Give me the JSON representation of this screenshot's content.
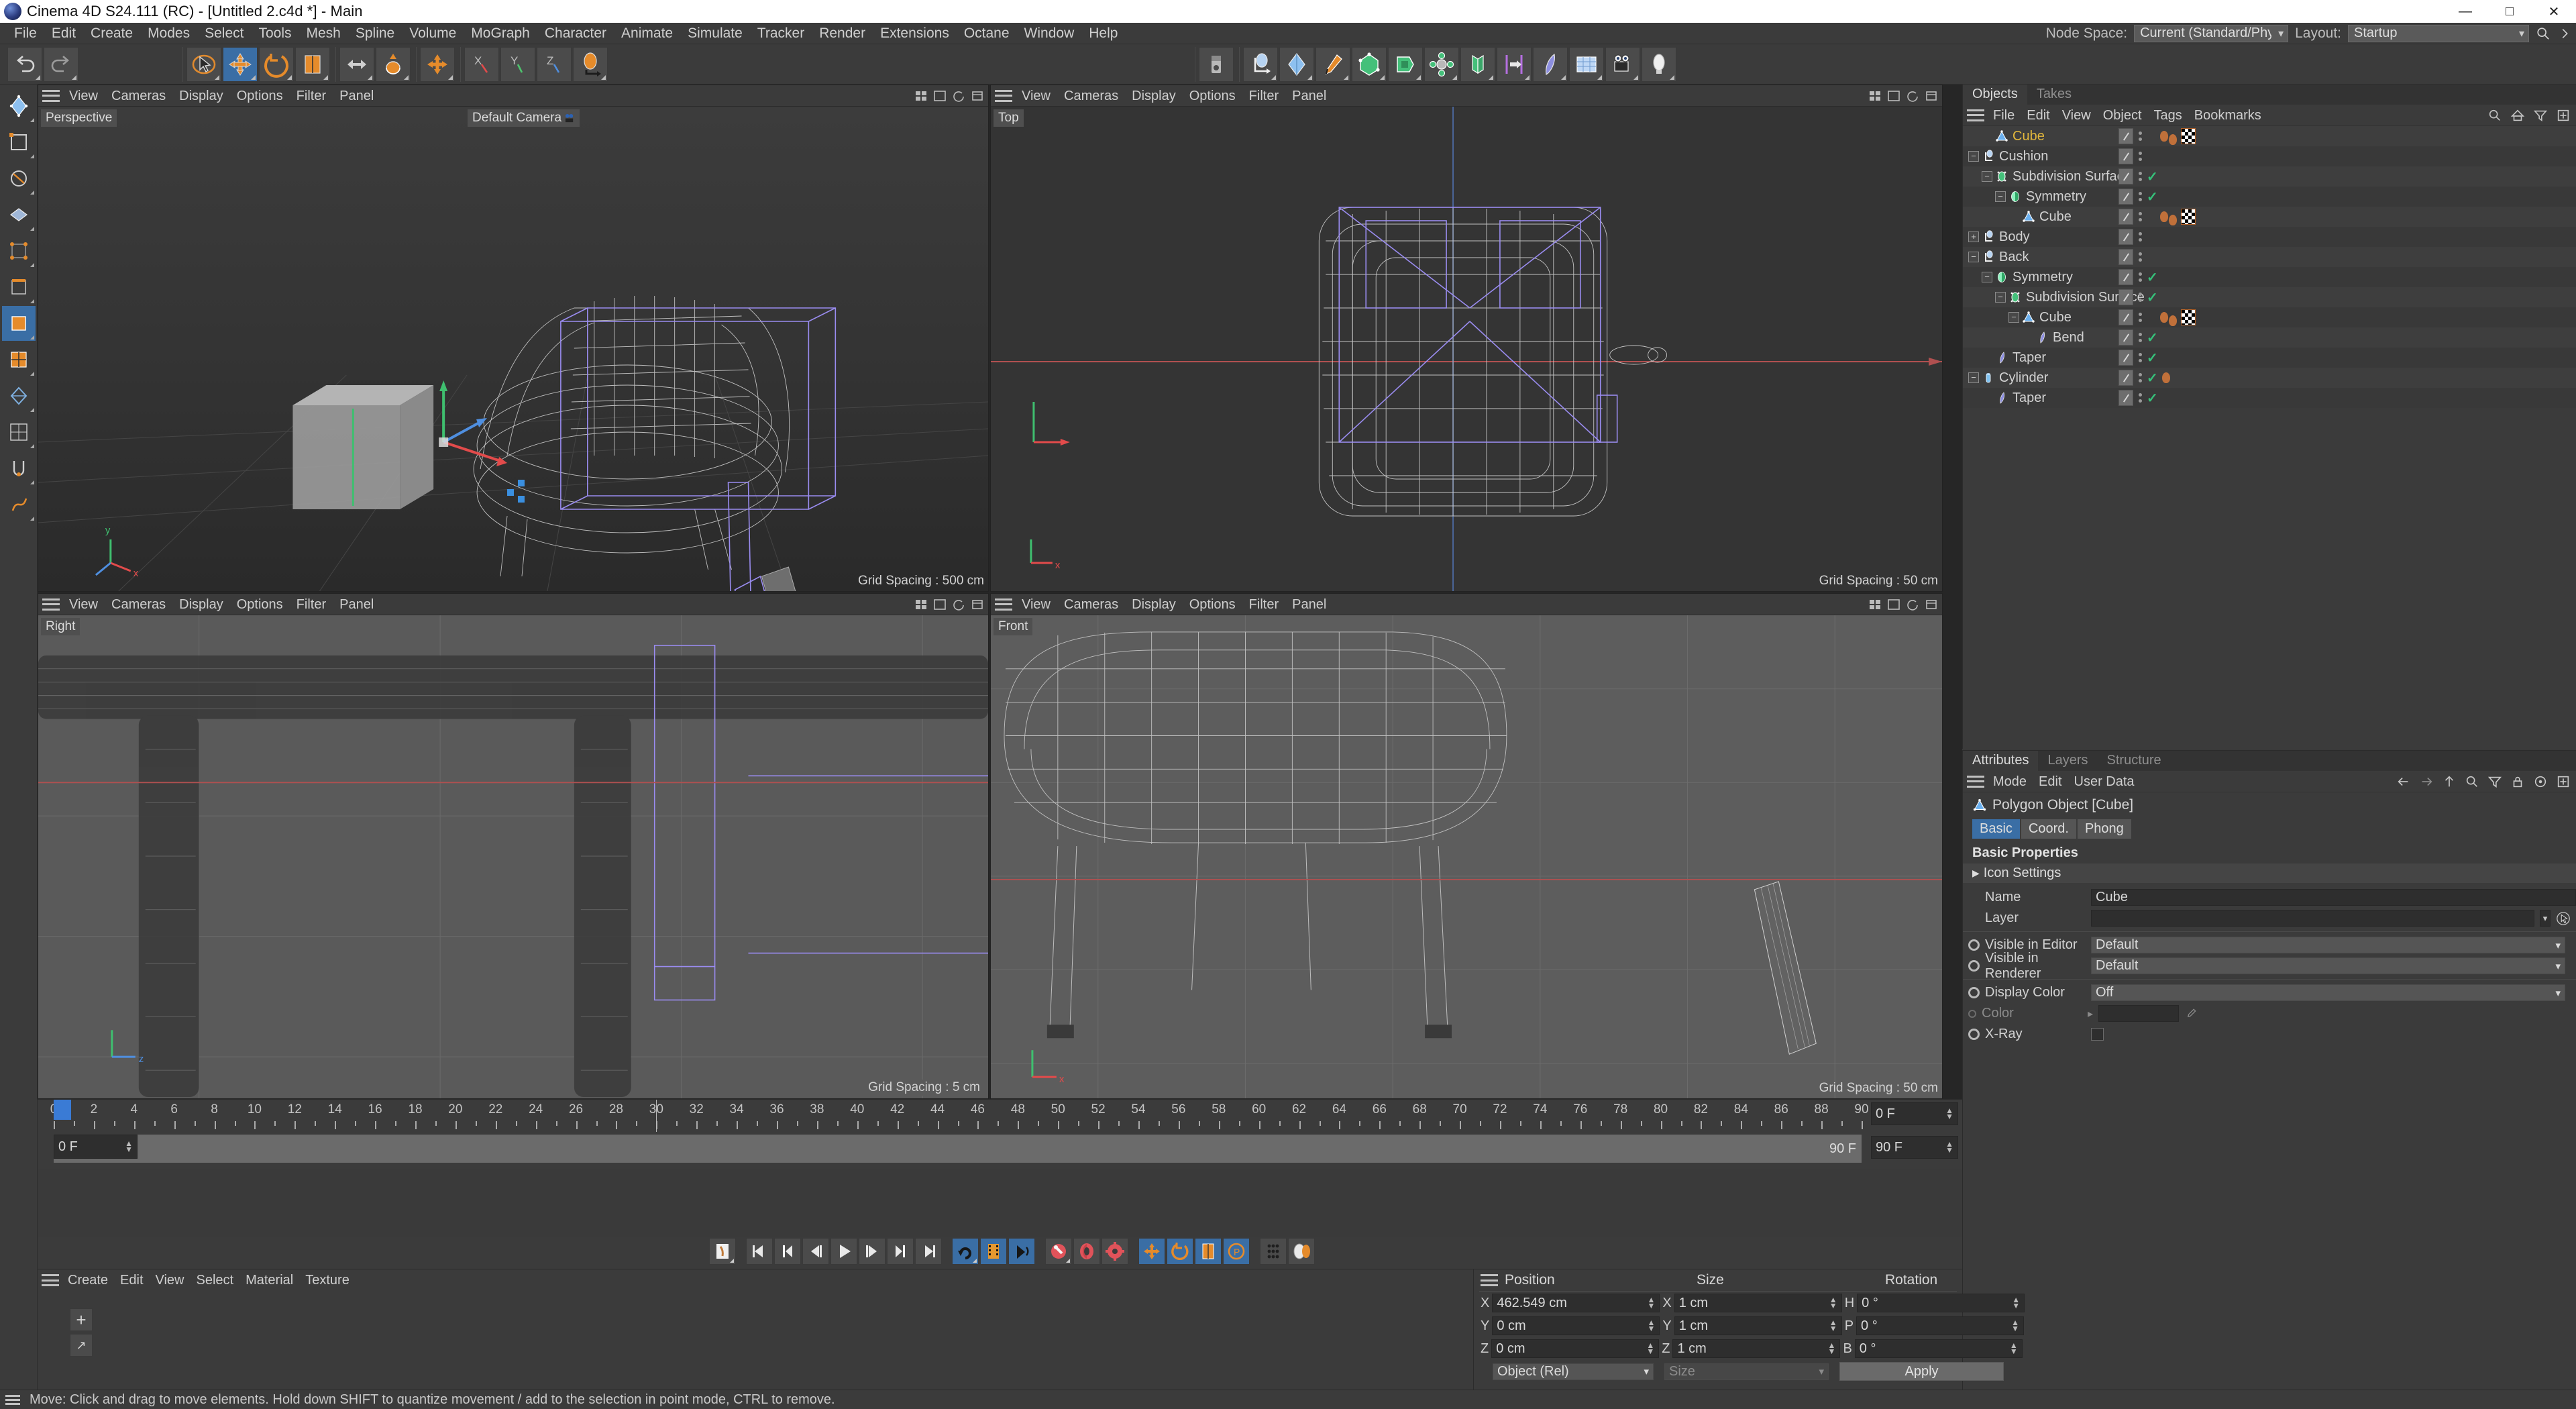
{
  "window": {
    "title": "Cinema 4D S24.111 (RC) - [Untitled 2.c4d *] - Main",
    "minimize": "—",
    "maximize": "□",
    "close": "✕"
  },
  "menubar": {
    "items": [
      "File",
      "Edit",
      "Create",
      "Modes",
      "Select",
      "Tools",
      "Mesh",
      "Spline",
      "Volume",
      "MoGraph",
      "Character",
      "Animate",
      "Simulate",
      "Tracker",
      "Render",
      "Extensions",
      "Octane",
      "Window",
      "Help"
    ],
    "node_space_label": "Node Space:",
    "node_space_value": "Current (Standard/Physical)",
    "layout_label": "Layout:",
    "layout_value": "Startup"
  },
  "viewports": [
    {
      "name": "Perspective",
      "menu": [
        "View",
        "Cameras",
        "Display",
        "Options",
        "Filter",
        "Panel"
      ],
      "camera": "Default Camera",
      "grid": "Grid Spacing : 500 cm",
      "grid_boxed": false
    },
    {
      "name": "Top",
      "menu": [
        "View",
        "Cameras",
        "Display",
        "Options",
        "Filter",
        "Panel"
      ],
      "camera": "",
      "grid": "Grid Spacing : 50 cm",
      "grid_boxed": false
    },
    {
      "name": "Right",
      "menu": [
        "View",
        "Cameras",
        "Display",
        "Options",
        "Filter",
        "Panel"
      ],
      "camera": "",
      "grid": "Grid Spacing : 5 cm",
      "grid_boxed": true
    },
    {
      "name": "Front",
      "menu": [
        "View",
        "Cameras",
        "Display",
        "Options",
        "Filter",
        "Panel"
      ],
      "camera": "",
      "grid": "Grid Spacing : 50 cm",
      "grid_boxed": false
    }
  ],
  "objects_panel": {
    "tabs": [
      {
        "label": "Objects",
        "active": true
      },
      {
        "label": "Takes",
        "active": false
      }
    ],
    "menu": [
      "File",
      "Edit",
      "View",
      "Object",
      "Tags",
      "Bookmarks"
    ],
    "tree": [
      {
        "name": "Cube",
        "depth": 1,
        "icon": "polygon",
        "expander": "none",
        "selected": true,
        "check": false,
        "beans": 2,
        "material": true
      },
      {
        "name": "Cushion",
        "depth": 0,
        "icon": "null",
        "expander": "minus",
        "selected": false,
        "check": false,
        "beans": 0,
        "material": false
      },
      {
        "name": "Subdivision Surface",
        "depth": 1,
        "icon": "subdiv",
        "expander": "minus",
        "selected": false,
        "check": true,
        "beans": 0,
        "material": false
      },
      {
        "name": "Symmetry",
        "depth": 2,
        "icon": "symmetry",
        "expander": "minus",
        "selected": false,
        "check": true,
        "beans": 0,
        "material": false
      },
      {
        "name": "Cube",
        "depth": 3,
        "icon": "polygon",
        "expander": "none",
        "selected": false,
        "check": false,
        "beans": 2,
        "material": true
      },
      {
        "name": "Body",
        "depth": 0,
        "icon": "null",
        "expander": "plus",
        "selected": false,
        "check": false,
        "beans": 0,
        "material": false
      },
      {
        "name": "Back",
        "depth": 0,
        "icon": "null",
        "expander": "minus",
        "selected": false,
        "check": false,
        "beans": 0,
        "material": false
      },
      {
        "name": "Symmetry",
        "depth": 1,
        "icon": "symmetry",
        "expander": "minus",
        "selected": false,
        "check": true,
        "beans": 0,
        "material": false
      },
      {
        "name": "Subdivision Surface",
        "depth": 2,
        "icon": "subdiv",
        "expander": "minus",
        "selected": false,
        "check": true,
        "beans": 0,
        "material": false
      },
      {
        "name": "Cube",
        "depth": 3,
        "icon": "polygon",
        "expander": "minus",
        "selected": false,
        "check": false,
        "beans": 2,
        "material": true
      },
      {
        "name": "Bend",
        "depth": 4,
        "icon": "deformer",
        "expander": "none",
        "selected": false,
        "check": true,
        "beans": 0,
        "material": false
      },
      {
        "name": "Taper",
        "depth": 1,
        "icon": "deformer",
        "expander": "none",
        "selected": false,
        "check": true,
        "beans": 0,
        "material": false
      },
      {
        "name": "Cylinder",
        "depth": 0,
        "icon": "cylinder",
        "expander": "minus",
        "selected": false,
        "check": true,
        "beans": 1,
        "material": false
      },
      {
        "name": "Taper",
        "depth": 1,
        "icon": "deformer",
        "expander": "none",
        "selected": false,
        "check": true,
        "beans": 0,
        "material": false
      }
    ]
  },
  "attributes_panel": {
    "tabs": [
      {
        "label": "Attributes",
        "active": true
      },
      {
        "label": "Layers",
        "active": false
      },
      {
        "label": "Structure",
        "active": false
      }
    ],
    "menu": [
      "Mode",
      "Edit",
      "User Data"
    ],
    "object_title": "Polygon Object [Cube]",
    "object_tabs": [
      {
        "label": "Basic",
        "active": true
      },
      {
        "label": "Coord.",
        "active": false
      },
      {
        "label": "Phong",
        "active": false
      }
    ],
    "section_title": "Basic Properties",
    "icon_settings": "Icon Settings",
    "rows": [
      {
        "label": "Name",
        "type": "field",
        "value": "Cube",
        "radio": false
      },
      {
        "label": "Layer",
        "type": "layer",
        "value": "",
        "radio": false
      },
      {
        "label": "Visible in Editor",
        "type": "drop",
        "value": "Default",
        "radio": true
      },
      {
        "label": "Visible in Renderer",
        "type": "drop",
        "value": "Default",
        "radio": true
      },
      {
        "label": "Display Color",
        "type": "drop",
        "value": "Off",
        "radio": true
      },
      {
        "label": "Color",
        "type": "color",
        "value": "",
        "radio": false,
        "dim": true
      },
      {
        "label": "X-Ray",
        "type": "check",
        "value": "",
        "radio": true
      }
    ]
  },
  "timeline": {
    "start_field": "0 F",
    "preview_start": "0 F",
    "preview_end": "90 F",
    "current_frame": "0 F",
    "end_field": "90 F",
    "ticks": [
      0,
      2,
      4,
      6,
      8,
      10,
      12,
      14,
      16,
      18,
      20,
      22,
      24,
      26,
      28,
      30,
      32,
      34,
      36,
      38,
      40,
      42,
      44,
      46,
      48,
      50,
      52,
      54,
      56,
      58,
      60,
      62,
      64,
      66,
      68,
      70,
      72,
      74,
      76,
      78,
      80,
      82,
      84,
      86,
      88,
      90
    ],
    "playhead": 30,
    "max": 90
  },
  "playback": {
    "buttons": [
      {
        "name": "record-active-objects",
        "style": "plain",
        "tri": true
      },
      {
        "name": "go-to-start",
        "style": "plain",
        "tri": false
      },
      {
        "name": "go-to-previous-key",
        "style": "plain",
        "tri": false
      },
      {
        "name": "go-to-previous-frame",
        "style": "plain",
        "tri": false
      },
      {
        "name": "play",
        "style": "plain",
        "tri": false
      },
      {
        "name": "go-to-next-frame",
        "style": "plain",
        "tri": false
      },
      {
        "name": "go-to-next-key",
        "style": "plain",
        "tri": false
      },
      {
        "name": "go-to-end",
        "style": "plain",
        "tri": false
      },
      {
        "name": "loop-playback",
        "style": "blue",
        "tri": true
      },
      {
        "name": "frame-preview-range",
        "style": "blue",
        "tri": false
      },
      {
        "name": "sound-playback",
        "style": "blue",
        "tri": false
      },
      {
        "name": "record-keyframe",
        "style": "plain",
        "tri": true
      },
      {
        "name": "autokeying",
        "style": "plain",
        "tri": false
      },
      {
        "name": "keyframe-selection",
        "style": "plain",
        "tri": false
      },
      {
        "name": "position-key",
        "style": "blue",
        "tri": false
      },
      {
        "name": "rotation-key",
        "style": "blue",
        "tri": false
      },
      {
        "name": "scale-key",
        "style": "blue",
        "tri": false
      },
      {
        "name": "parameter-key",
        "style": "blue",
        "tri": false
      },
      {
        "name": "point-level-animation",
        "style": "plain",
        "tri": false
      },
      {
        "name": "motion-clip",
        "style": "plain",
        "tri": false
      }
    ]
  },
  "material_manager": {
    "menu": [
      "Create",
      "Edit",
      "View",
      "Select",
      "Material",
      "Texture"
    ],
    "add_label": "+"
  },
  "coordinates": {
    "columns": [
      "Position",
      "Size",
      "Rotation"
    ],
    "rows": [
      {
        "pos_axis": "X",
        "pos": "462.549 cm",
        "size_axis": "X",
        "size": "1 cm",
        "rot_axis": "H",
        "rot": "0 °"
      },
      {
        "pos_axis": "Y",
        "pos": "0 cm",
        "size_axis": "Y",
        "size": "1 cm",
        "rot_axis": "P",
        "rot": "0 °"
      },
      {
        "pos_axis": "Z",
        "pos": "0 cm",
        "size_axis": "Z",
        "size": "1 cm",
        "rot_axis": "B",
        "rot": "0 °"
      }
    ],
    "mode_value": "Object (Rel)",
    "size_value": "Size",
    "apply_label": "Apply"
  },
  "statusbar": {
    "message": "Move: Click and drag to move elements. Hold down SHIFT to quantize movement / add to the selection in point mode, CTRL to remove."
  },
  "colors": {
    "accent_blue": "#3a6ea5",
    "selected_object": "#e3b83c",
    "check_green": "#36c07a",
    "panel_bg": "#3b3b3b",
    "viewport_bg": "#2b2b2b",
    "timeline_blue": "#3a7bd5"
  }
}
